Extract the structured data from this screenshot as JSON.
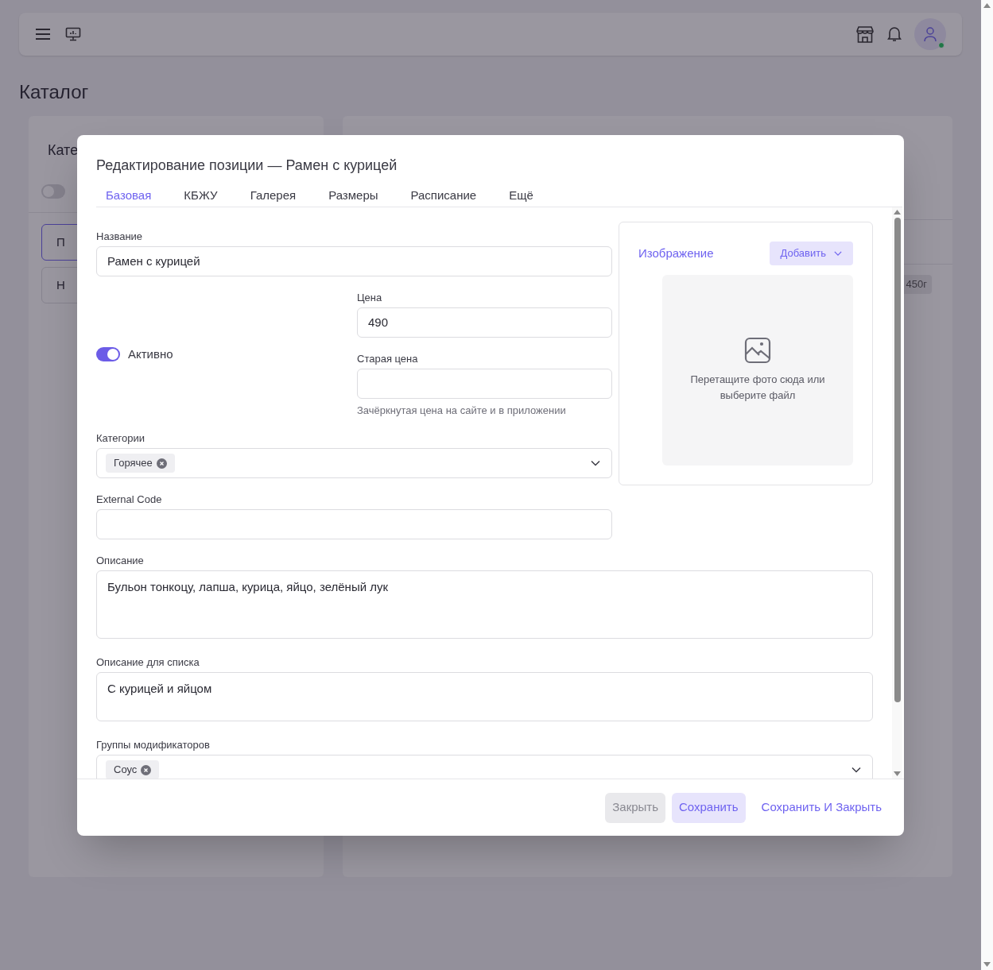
{
  "page_title": "Каталог",
  "background": {
    "left_card_title": "Кате",
    "filter_toggle": {
      "on": false
    },
    "list_items": [
      {
        "label": "П",
        "selected": true
      },
      {
        "label": "Н",
        "selected": false
      }
    ],
    "right_badge": "450г"
  },
  "dialog": {
    "title": "Редактирование позиции — Рамен с курицей",
    "tabs": [
      {
        "label": "Базовая",
        "selected": true
      },
      {
        "label": "КБЖУ",
        "selected": false
      },
      {
        "label": "Галерея",
        "selected": false
      },
      {
        "label": "Размеры",
        "selected": false
      },
      {
        "label": "Расписание",
        "selected": false
      },
      {
        "label": "Ещё",
        "selected": false
      }
    ],
    "name": {
      "label": "Название",
      "value": "Рамен с курицей"
    },
    "active": {
      "label": "Активно",
      "on": true
    },
    "price": {
      "label": "Цена",
      "value": "490"
    },
    "old_price": {
      "label": "Старая цена",
      "hint": "Зачёркнутая цена на сайте и в приложении"
    },
    "categories": {
      "label": "Категории",
      "tags": [
        "Горячее"
      ]
    },
    "external_code": {
      "label": "External Code"
    },
    "description": {
      "label": "Описание",
      "value": "Бульон тонкоцу, лапша, курица, яйцо, зелёный лук"
    },
    "list_description": {
      "label": "Описание для списка",
      "value": "С курицей и яйцом"
    },
    "modifier_groups": {
      "label": "Группы модификаторов",
      "tags": [
        "Соус"
      ]
    },
    "image_panel": {
      "title": "Изображение",
      "add_button": "Добавить",
      "drop_hint": "Перетащите фото сюда или выберите файл"
    },
    "buttons": [
      {
        "label": "Закрыть",
        "kind": "secondary"
      },
      {
        "label": "Сохранить",
        "kind": "primary"
      },
      {
        "label": "Сохранить И Закрыть",
        "kind": "link"
      }
    ]
  }
}
